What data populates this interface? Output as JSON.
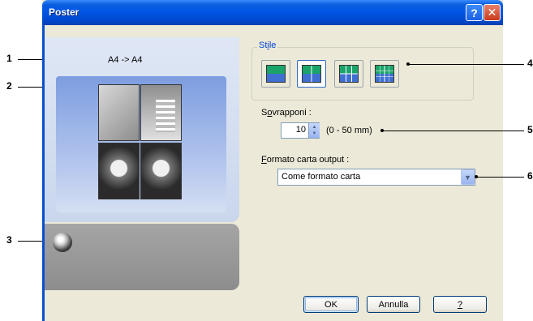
{
  "window": {
    "title": "Poster",
    "help_button": "?",
    "close_button": "✕"
  },
  "preview": {
    "paper_label": "A4 -> A4"
  },
  "stile": {
    "label_prefix": "St",
    "label_mnemonic": "i",
    "label_suffix": "le",
    "styles": [
      "1x1",
      "2x2",
      "3x3",
      "4x4"
    ],
    "selected_index": 1
  },
  "overlap": {
    "label_prefix": "S",
    "label_mnemonic": "o",
    "label_suffix": "vrapponi :",
    "value": "10",
    "range": "(0 - 50 mm)"
  },
  "output_paper": {
    "label_mnemonic": "F",
    "label_suffix": "ormato carta output :",
    "selected": "Come formato carta"
  },
  "buttons": {
    "ok": "OK",
    "cancel": "Annulla",
    "help": "?"
  },
  "callouts": [
    "1",
    "2",
    "3",
    "4",
    "5",
    "6"
  ]
}
